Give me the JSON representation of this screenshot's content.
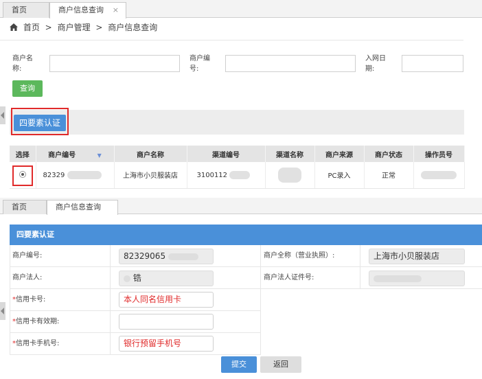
{
  "top": {
    "tabs": [
      {
        "label": "首页",
        "active": false
      },
      {
        "label": "商户信息查询",
        "active": true,
        "close": "×"
      }
    ],
    "breadcrumb": {
      "home": "首页",
      "sep": ">",
      "level2": "商户管理",
      "level3": "商户信息查询"
    },
    "filters": {
      "merchant_name_label": "商户名称:",
      "merchant_no_label": "商户编号:",
      "join_date_label": "入网日期:"
    },
    "query_button": "查询",
    "four_factor_button": "四要素认证",
    "table": {
      "headers": [
        "选择",
        "商户编号",
        "商户名称",
        "渠道编号",
        "渠道名称",
        "商户来源",
        "商户状态",
        "操作员号"
      ],
      "rows": [
        {
          "merchant_no": "82329",
          "merchant_name": "上海市小贝服装店",
          "channel_no": "3100112",
          "channel_name": "",
          "source": "PC录入",
          "status": "正常",
          "operator": ""
        }
      ]
    }
  },
  "bottom": {
    "tabs": [
      {
        "label": "首页",
        "active": false
      },
      {
        "label": "商户信息查询",
        "active": true
      }
    ],
    "panel_title": "四要素认证",
    "fields": {
      "merchant_no_label": "商户编号:",
      "merchant_no_value": "82329065",
      "full_name_label": "商户全称（营业执照）:",
      "full_name_value": "上海市小贝服装店",
      "legal_person_label": "商户法人:",
      "legal_person_value": "锆",
      "legal_id_label": "商户法人证件号:",
      "legal_id_value": "",
      "card_no_label": "信用卡号:",
      "card_no_value": "本人同名信用卡",
      "card_expiry_label": "信用卡有效期:",
      "card_expiry_value": "",
      "card_phone_label": "信用卡手机号:",
      "card_phone_value": "银行预留手机号",
      "required_mark": "*"
    },
    "submit_button": "提交",
    "back_button": "返回"
  },
  "colors": {
    "primary": "#4a90d9",
    "success": "#5cb85c",
    "highlight": "#e02a2a"
  }
}
